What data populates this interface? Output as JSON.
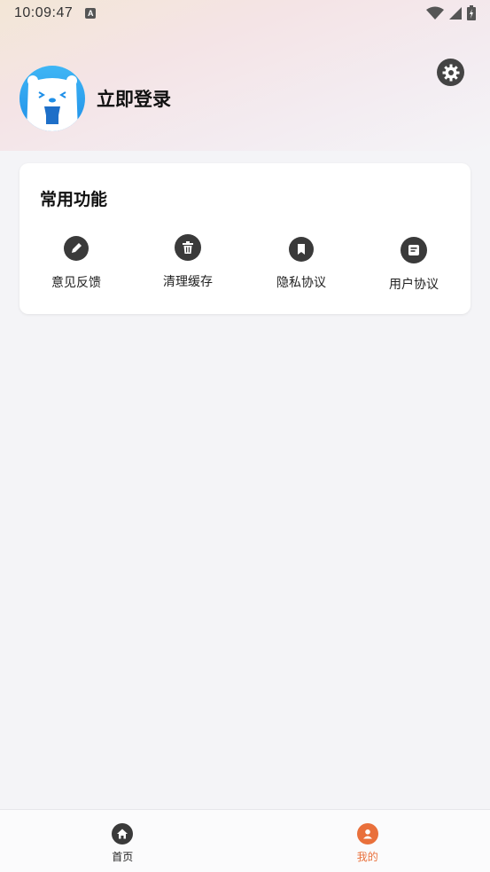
{
  "status_bar": {
    "time": "10:09:47",
    "notification_icon": "a-icon"
  },
  "profile": {
    "login_label": "立即登录",
    "avatar_icon": "bear-avatar-icon"
  },
  "settings": {
    "icon": "gear-icon"
  },
  "common_functions": {
    "title": "常用功能",
    "items": [
      {
        "label": "意见反馈",
        "icon": "pencil-icon"
      },
      {
        "label": "清理缓存",
        "icon": "trash-icon"
      },
      {
        "label": "隐私协议",
        "icon": "bookmark-icon"
      },
      {
        "label": "用户协议",
        "icon": "document-icon"
      }
    ]
  },
  "tabbar": {
    "tabs": [
      {
        "label": "首页",
        "icon": "home-icon",
        "active": false
      },
      {
        "label": "我的",
        "icon": "user-icon",
        "active": true
      }
    ]
  },
  "colors": {
    "accent": "#e9703b",
    "icon_dark": "#3a3a3a",
    "background": "#f4f4f7"
  }
}
